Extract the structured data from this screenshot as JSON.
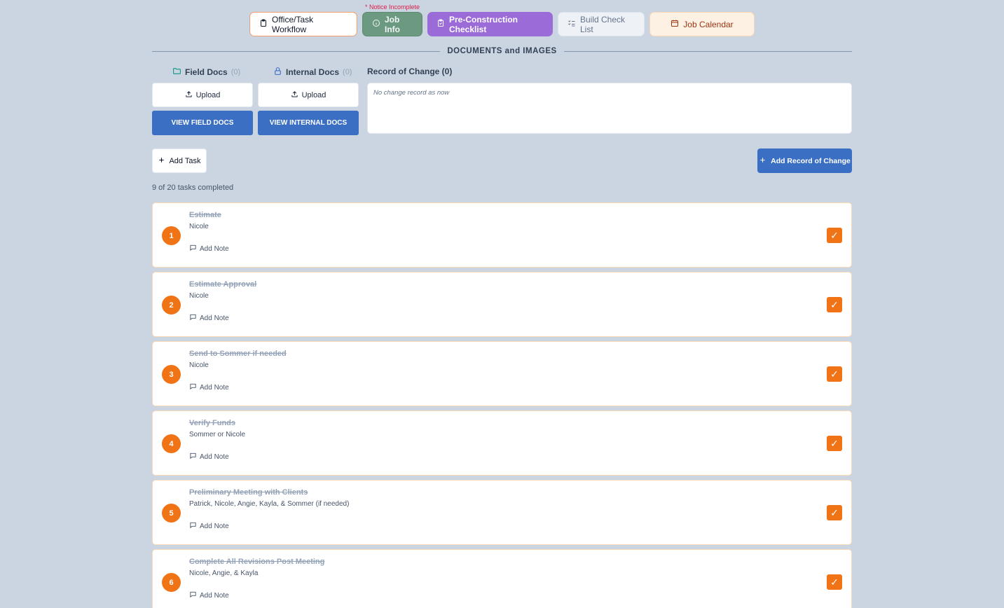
{
  "notice": "* Notice Incomplete",
  "tabs": [
    {
      "label": "Office/Task Workflow",
      "icon": "clipboard-icon"
    },
    {
      "label": "Job Info",
      "icon": "info-icon"
    },
    {
      "label": "Pre-Construction Checklist",
      "icon": "clipboard-check-icon"
    },
    {
      "label": "Build Check List",
      "icon": "list-checks-icon"
    },
    {
      "label": "Job Calendar",
      "icon": "calendar-icon"
    }
  ],
  "section_title": "DOCUMENTS and IMAGES",
  "field_docs": {
    "label": "Field Docs",
    "count": "(0)",
    "upload": "Upload",
    "view": "VIEW FIELD DOCS"
  },
  "internal_docs": {
    "label": "Internal Docs",
    "count": "(0)",
    "upload": "Upload",
    "view": "VIEW INTERNAL DOCS"
  },
  "record_of_change": {
    "title": "Record of Change (0)",
    "empty": "No change record as now",
    "add_label": "Add Record of Change"
  },
  "add_task_label": "Add Task",
  "progress": "9 of 20 tasks completed",
  "add_note_label": "Add Note",
  "colors": {
    "accent_orange": "#f07316",
    "primary_blue": "#3b6fc4",
    "background": "#cbd5e1"
  },
  "tasks": [
    {
      "num": "1",
      "title": "Estimate",
      "assignee": "Nicole",
      "done": true
    },
    {
      "num": "2",
      "title": "Estimate Approval",
      "assignee": "Nicole",
      "done": true
    },
    {
      "num": "3",
      "title": "Send to Sommer if needed",
      "assignee": "Nicole",
      "done": true
    },
    {
      "num": "4",
      "title": "Verify Funds",
      "assignee": "Sommer or Nicole",
      "done": true
    },
    {
      "num": "5",
      "title": "Preliminary Meeting with Clients",
      "assignee": "Patrick, Nicole, Angie, Kayla, & Sommer (if needed)",
      "done": true
    },
    {
      "num": "6",
      "title": "Complete All Revisions Post Meeting",
      "assignee": "Nicole, Angie, & Kayla",
      "done": true
    }
  ]
}
